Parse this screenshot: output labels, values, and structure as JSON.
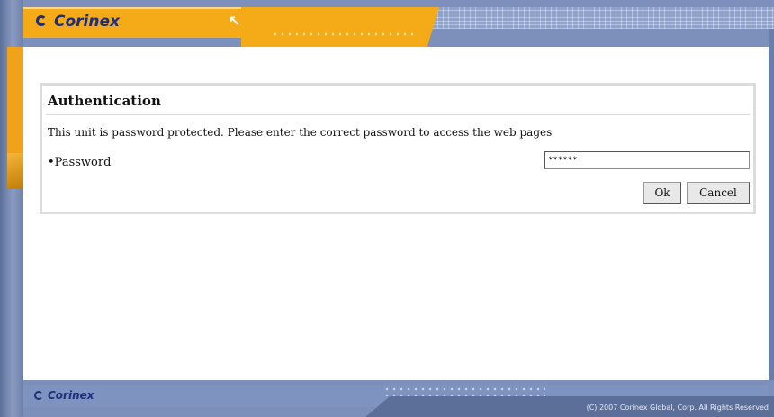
{
  "header": {
    "logo_text": "Corinex",
    "arrow_icon": "arrow-up-left-icon"
  },
  "auth": {
    "title": "Authentication",
    "message": "This unit is password protected. Please enter the correct password to access the web pages",
    "password_label": "•Password",
    "password_value": "******",
    "ok_label": "Ok",
    "cancel_label": "Cancel"
  },
  "footer": {
    "logo_text": "Corinex",
    "copyright": "(C) 2007 Corinex Global, Corp. All Rights Reserved"
  },
  "colors": {
    "accent_orange": "#f5ab18",
    "frame_blue": "#7d90bb",
    "logo_navy": "#1f2d7a"
  }
}
